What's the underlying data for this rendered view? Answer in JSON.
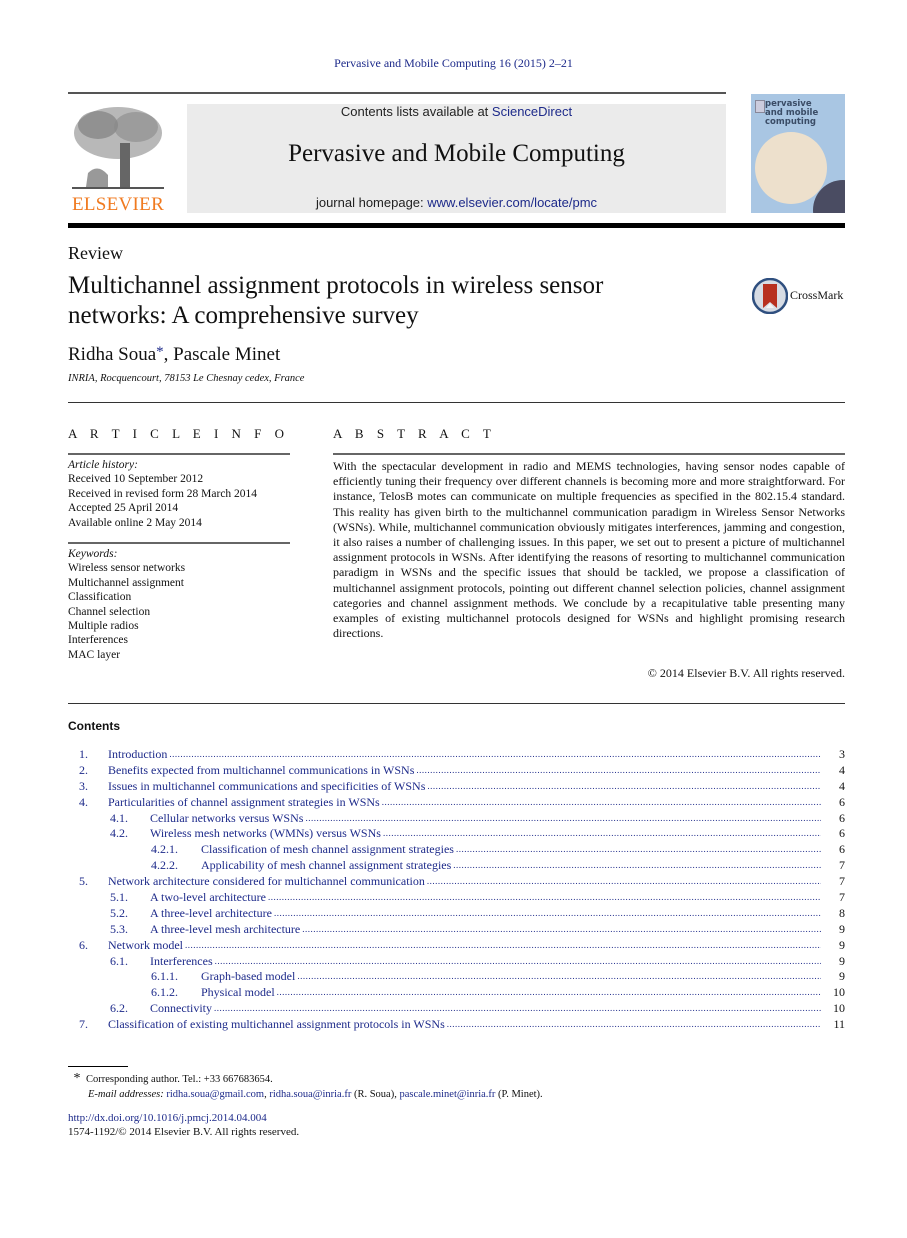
{
  "running_head": "Pervasive and Mobile Computing 16 (2015) 2–21",
  "header": {
    "publisher": "ELSEVIER",
    "contents_prefix": "Contents lists available at ",
    "contents_link": "ScienceDirect",
    "journal_title": "Pervasive and Mobile Computing",
    "homepage_prefix": "journal homepage: ",
    "homepage_link": "www.elsevier.com/locate/pmc",
    "cover_lines": [
      "pervasive",
      "and mobile",
      "computing"
    ],
    "colors": {
      "publisher_orange": "#f07a20",
      "link_blue": "#1d2a8a",
      "banner_gray": "#ebebeb",
      "cover_blue": "#a9c6e3"
    }
  },
  "article": {
    "type": "Review",
    "title": "Multichannel assignment protocols in wireless sensor networks: A comprehensive survey",
    "crossmark_label": "CrossMark",
    "authors": [
      {
        "name": "Ridha Soua",
        "mark": "*"
      },
      {
        "name": "Pascale Minet",
        "mark": ""
      }
    ],
    "affiliation": "INRIA, Rocquencourt, 78153 Le Chesnay cedex, France"
  },
  "article_info": {
    "heading": "ARTICLE INFO",
    "history_label": "Article history:",
    "history": [
      "Received 10 September 2012",
      "Received in revised form 28 March 2014",
      "Accepted 25 April 2014",
      "Available online 2 May 2014"
    ],
    "keywords_label": "Keywords:",
    "keywords": [
      "Wireless sensor networks",
      "Multichannel assignment",
      "Classification",
      "Channel selection",
      "Multiple radios",
      "Interferences",
      "MAC layer"
    ]
  },
  "abstract": {
    "heading": "ABSTRACT",
    "text": "With the spectacular development in radio and MEMS technologies, having sensor nodes capable of efficiently tuning their frequency over different channels is becoming more and more straightforward. For instance, TelosB motes can communicate on multiple frequencies as specified in the 802.15.4 standard. This reality has given birth to the multichannel communication paradigm in Wireless Sensor Networks (WSNs). While, multichannel communication obviously mitigates interferences, jamming and congestion, it also raises a number of challenging issues. In this paper, we set out to present a picture of multichannel assignment protocols in WSNs. After identifying the reasons of resorting to multichannel communication paradigm in WSNs and the specific issues that should be tackled, we propose a classification of multichannel assignment protocols, pointing out different channel selection policies, channel assignment categories and channel assignment methods. We conclude by a recapitulative table presenting many examples of existing multichannel protocols designed for WSNs and highlight promising research directions.",
    "copyright": "© 2014 Elsevier B.V. All rights reserved."
  },
  "contents": {
    "heading": "Contents",
    "entries": [
      {
        "num": "1.",
        "title": "Introduction",
        "page": "3",
        "level": 1
      },
      {
        "num": "2.",
        "title": "Benefits expected from multichannel communications in WSNs",
        "page": "4",
        "level": 1
      },
      {
        "num": "3.",
        "title": "Issues in multichannel communications and specificities of WSNs",
        "page": "4",
        "level": 1
      },
      {
        "num": "4.",
        "title": "Particularities of channel assignment strategies in WSNs",
        "page": "6",
        "level": 1
      },
      {
        "num": "4.1.",
        "title": "Cellular networks versus WSNs",
        "page": "6",
        "level": 2
      },
      {
        "num": "4.2.",
        "title": "Wireless mesh networks (WMNs) versus WSNs",
        "page": "6",
        "level": 2
      },
      {
        "num": "4.2.1.",
        "title": "Classification of mesh channel assignment strategies",
        "page": "6",
        "level": 3
      },
      {
        "num": "4.2.2.",
        "title": "Applicability of mesh channel assignment strategies",
        "page": "7",
        "level": 3
      },
      {
        "num": "5.",
        "title": "Network architecture considered for multichannel communication",
        "page": "7",
        "level": 1
      },
      {
        "num": "5.1.",
        "title": "A two-level architecture",
        "page": "7",
        "level": 2
      },
      {
        "num": "5.2.",
        "title": "A three-level architecture",
        "page": "8",
        "level": 2
      },
      {
        "num": "5.3.",
        "title": "A three-level mesh architecture",
        "page": "9",
        "level": 2
      },
      {
        "num": "6.",
        "title": "Network model",
        "page": "9",
        "level": 1
      },
      {
        "num": "6.1.",
        "title": "Interferences",
        "page": "9",
        "level": 2
      },
      {
        "num": "6.1.1.",
        "title": "Graph-based model",
        "page": "9",
        "level": 3
      },
      {
        "num": "6.1.2.",
        "title": "Physical model",
        "page": "10",
        "level": 3
      },
      {
        "num": "6.2.",
        "title": "Connectivity",
        "page": "10",
        "level": 2
      },
      {
        "num": "7.",
        "title": "Classification of existing multichannel assignment protocols in WSNs",
        "page": "11",
        "level": 1
      }
    ]
  },
  "footnote": {
    "mark": "*",
    "corresponding": "Corresponding author. Tel.: +33 667683654.",
    "email_label": "E-mail addresses:",
    "emails": [
      {
        "address": "ridha.soua@gmail.com",
        "after": ", "
      },
      {
        "address": "ridha.soua@inria.fr",
        "after": " (R. Soua), "
      },
      {
        "address": "pascale.minet@inria.fr",
        "after": " (P. Minet)."
      }
    ]
  },
  "doi": {
    "link": "http://dx.doi.org/10.1016/j.pmcj.2014.04.004",
    "issn_line": "1574-1192/© 2014 Elsevier B.V. All rights reserved."
  }
}
